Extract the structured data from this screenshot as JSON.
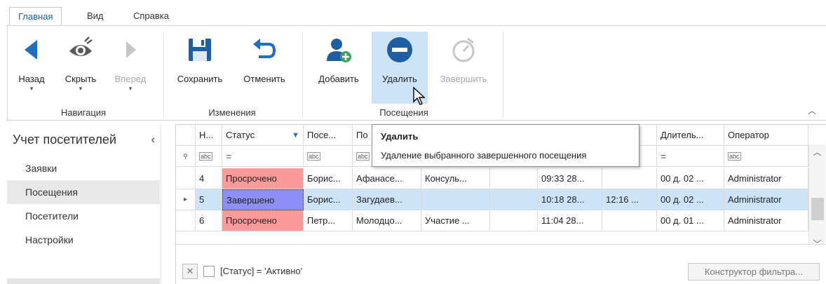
{
  "ribbon": {
    "tabs": [
      "Главная",
      "Вид",
      "Справка"
    ],
    "groups": {
      "navigation": {
        "label": "Навигация",
        "buttons": [
          {
            "label": "Назад",
            "icon": "arrow-left-icon",
            "enabled": true
          },
          {
            "label": "Скрыть",
            "icon": "eye-icon",
            "enabled": true
          },
          {
            "label": "Вперед",
            "icon": "arrow-right-icon",
            "enabled": false
          }
        ]
      },
      "changes": {
        "label": "Изменения",
        "buttons": [
          {
            "label": "Сохранить",
            "icon": "save-icon",
            "enabled": true
          },
          {
            "label": "Отменить",
            "icon": "undo-icon",
            "enabled": true
          }
        ]
      },
      "visits": {
        "label": "Посещения",
        "buttons": [
          {
            "label": "Добавить",
            "icon": "add-user-icon",
            "enabled": true
          },
          {
            "label": "Удалить",
            "icon": "remove-icon",
            "enabled": true
          },
          {
            "label": "Завершить",
            "icon": "stopwatch-icon",
            "enabled": false
          }
        ]
      }
    }
  },
  "sidebar": {
    "title": "Учет посетителей",
    "items": [
      "Заявки",
      "Посещения",
      "Посетители",
      "Настройки"
    ],
    "selected": "Посещения"
  },
  "grid": {
    "columns": [
      "Н...",
      "Статус",
      "Посе...",
      "По",
      "",
      "",
      "",
      "...",
      "Длитель...",
      "Оператор"
    ],
    "filter_row_equals": "=",
    "rows": [
      {
        "num": "4",
        "status": "Просрочено",
        "visitor": "Борис...",
        "host": "Афанасе...",
        "purpose": "Консуль...",
        "c5": "",
        "start": "09:33 28...",
        "end": "",
        "duration": "00 д. 02 ...",
        "operator": "Administrator"
      },
      {
        "num": "5",
        "status": "Завершено",
        "visitor": "Борис...",
        "host": "Загудаев...",
        "purpose": "",
        "c5": "",
        "start": "10:18 28...",
        "end": "12:16 ...",
        "duration": "00 д. 02 ...",
        "operator": "Administrator"
      },
      {
        "num": "6",
        "status": "Просрочено",
        "visitor": "Петр...",
        "host": "Молодцо...",
        "purpose": "Участие ...",
        "c5": "",
        "start": "11:04 28...",
        "end": "",
        "duration": "00 д. 01 ...",
        "operator": "Administrator"
      }
    ],
    "filter_text": "[Статус] = 'Активно'",
    "filter_builder_button": "Конструктор фильтра..."
  },
  "tooltip": {
    "title": "Удалить",
    "description": "Удаление выбранного завершенного посещения"
  },
  "colors": {
    "accent": "#1c5fa8",
    "overdue": "#fb9a9a",
    "completed": "#8e8ef7",
    "selected_row": "#cce3f8",
    "button_hover": "#cde3f7"
  }
}
